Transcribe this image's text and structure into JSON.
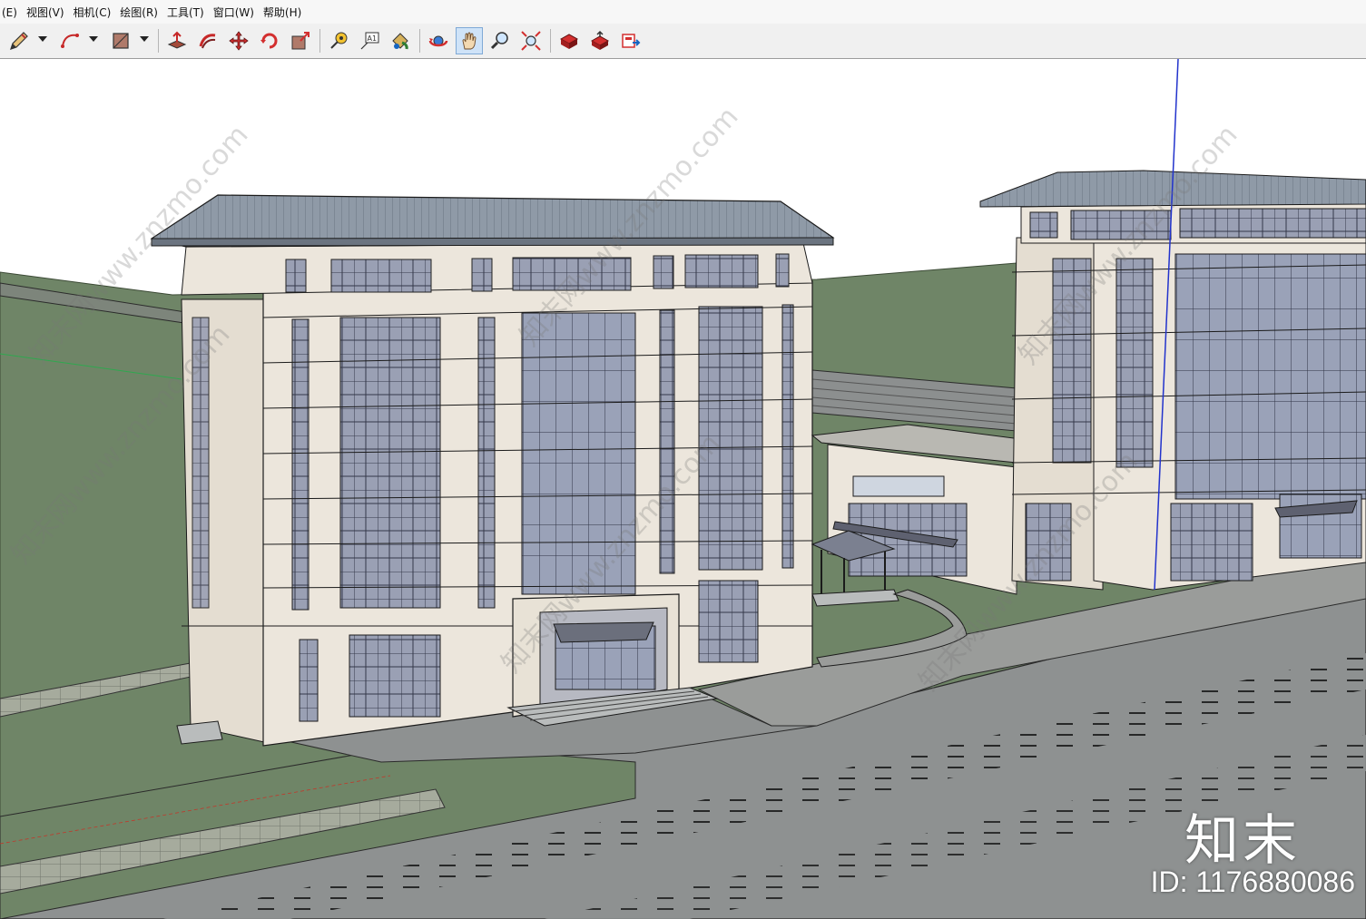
{
  "menu": {
    "items": [
      {
        "label": "(E)"
      },
      {
        "label": "视图(V)"
      },
      {
        "label": "相机(C)"
      },
      {
        "label": "绘图(R)"
      },
      {
        "label": "工具(T)"
      },
      {
        "label": "窗口(W)"
      },
      {
        "label": "帮助(H)"
      }
    ]
  },
  "toolbar": {
    "tools": [
      {
        "icon": "pencil-icon",
        "has_dropdown": true
      },
      {
        "icon": "arc-icon",
        "has_dropdown": true
      },
      {
        "icon": "rectangle-icon",
        "has_dropdown": true
      },
      {
        "icon": "push-pull-icon"
      },
      {
        "icon": "follow-me-icon"
      },
      {
        "icon": "move-icon"
      },
      {
        "icon": "rotate-icon"
      },
      {
        "icon": "scale-icon"
      },
      {
        "icon": "tape-measure-icon"
      },
      {
        "icon": "text-icon",
        "text": "A1"
      },
      {
        "icon": "paint-bucket-icon"
      },
      {
        "icon": "orbit-icon"
      },
      {
        "icon": "pan-hand-icon",
        "active": true
      },
      {
        "icon": "zoom-icon"
      },
      {
        "icon": "zoom-extents-icon"
      },
      {
        "icon": "warehouse-icon"
      },
      {
        "icon": "share-model-icon"
      },
      {
        "icon": "extension-warehouse-icon"
      }
    ]
  },
  "viewport": {
    "scene": "3D model of office buildings with roads",
    "colors": {
      "sky": "#ffffff",
      "grass": "#6f8567",
      "road": "#8e9191",
      "facade": "#ece6dc",
      "glass": "#9aa0b4",
      "roof": "#8f9aa7"
    }
  },
  "watermark": {
    "brand": "知末",
    "id_text": "ID: 1176880086",
    "site_text": "知末网www.znzmo.com"
  }
}
